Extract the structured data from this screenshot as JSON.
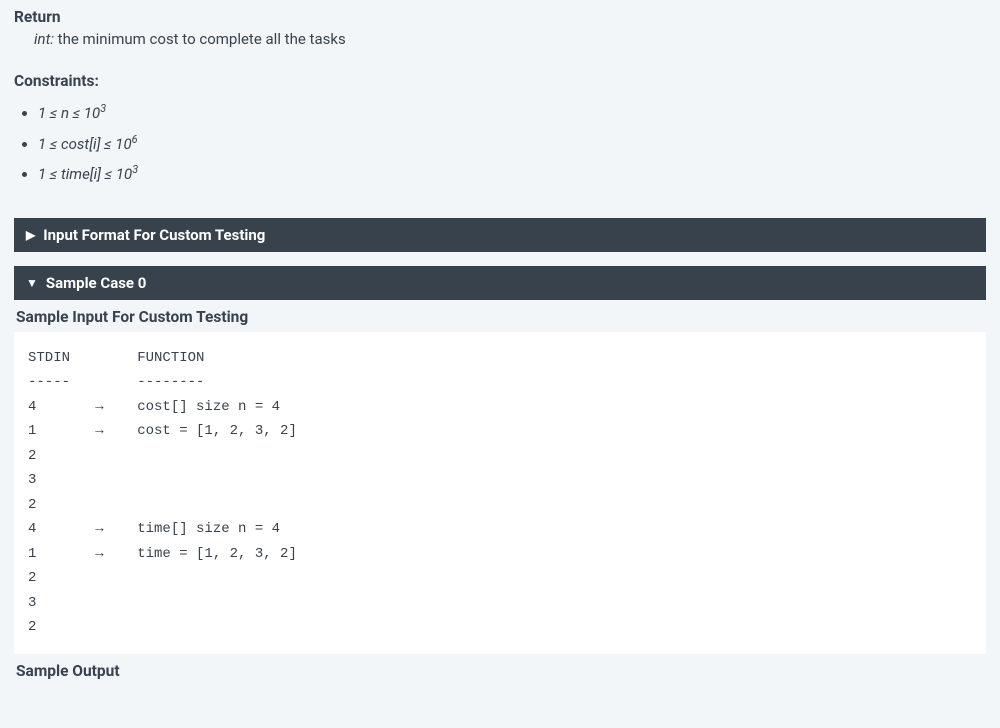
{
  "return": {
    "heading": "Return",
    "type": "int:",
    "desc": " the minimum cost to complete all the tasks"
  },
  "constraints": {
    "heading": "Constraints:",
    "items": [
      {
        "expr": "1 ≤ n ≤ 10",
        "sup": "3"
      },
      {
        "expr": "1 ≤ cost[i] ≤ 10",
        "sup": "6"
      },
      {
        "expr": "1 ≤ time[i] ≤ 10",
        "sup": "3"
      }
    ]
  },
  "panels": {
    "input_format": {
      "label": "Input Format For Custom Testing",
      "state": "collapsed"
    },
    "sample0": {
      "label": "Sample Case 0",
      "state": "expanded"
    }
  },
  "sample": {
    "input_heading": "Sample Input For Custom Testing",
    "code": "STDIN        FUNCTION\n-----        --------\n4       →    cost[] size n = 4\n1       →    cost = [1, 2, 3, 2]\n2\n3\n2\n4       →    time[] size n = 4\n1       →    time = [1, 2, 3, 2]\n2\n3\n2",
    "output_heading": "Sample Output"
  }
}
